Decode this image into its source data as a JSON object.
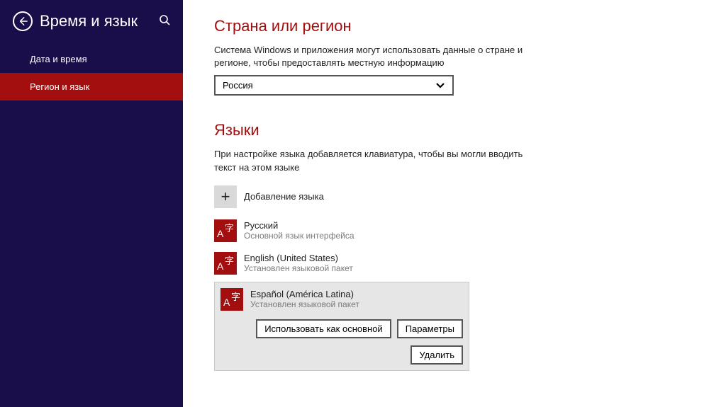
{
  "header": {
    "title": "Время и язык"
  },
  "nav": {
    "items": [
      {
        "label": "Дата и время"
      },
      {
        "label": "Регион и язык"
      }
    ]
  },
  "region": {
    "title": "Страна или регион",
    "desc": "Система Windows и приложения могут использовать данные о стране и регионе, чтобы предоставлять местную информацию",
    "selected": "Россия"
  },
  "languages": {
    "title": "Языки",
    "desc": "При настройке языка добавляется клавиатура, чтобы вы могли вводить текст на этом языке",
    "add_label": "Добавление языка",
    "items": [
      {
        "name": "Русский",
        "sub": "Основной язык интерфейса"
      },
      {
        "name": "English (United States)",
        "sub": "Установлен языковой пакет"
      },
      {
        "name": "Español (América Latina)",
        "sub": "Установлен языковой пакет"
      }
    ],
    "actions": {
      "set_primary": "Использовать как основной",
      "options": "Параметры",
      "remove": "Удалить"
    }
  }
}
